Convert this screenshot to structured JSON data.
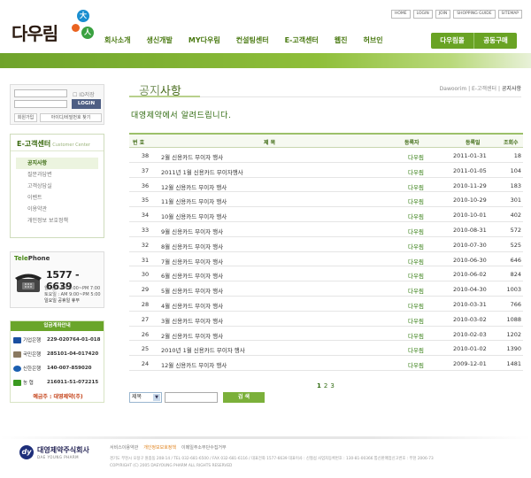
{
  "brand": {
    "tagline": "",
    "name": "다우림",
    "dot1": "大",
    "dot3": "人"
  },
  "util_links": [
    "HOME",
    "LOGIN",
    "JOIN",
    "SHOPPING GUIDE",
    "SITEMAP"
  ],
  "gnb": [
    "회사소개",
    "생신개발",
    "MY다우림",
    "컨설팅센터",
    "E-고객센터",
    "웹진",
    "허브인"
  ],
  "shop_buttons": [
    "다우림몰",
    "공동구매"
  ],
  "login": {
    "save_id": "ID저장",
    "login_button": "LOGIN",
    "join": "회원가입",
    "find": "아이디/비밀번호 찾기"
  },
  "side": {
    "title": "E-고객센터",
    "subtitle": "Customer Center",
    "items": [
      "공지사항",
      "질문과답변",
      "고객상담실",
      "이벤트",
      "이용약관",
      "개인정보 보호정책"
    ],
    "active_index": 0
  },
  "telephone": {
    "title_a": "Tele",
    "title_b": "Phone",
    "number": "1577 - 6639",
    "hours1": "월~금 : AM 9:00~PM 7:00",
    "hours2": "토요일 : AM 9:00~PM 5:00",
    "hours3": "일요일 공휴일 휴무"
  },
  "bank": {
    "title": "입금계좌안내",
    "accounts": [
      {
        "bank": "기업은행",
        "account": "229-020764-01-018",
        "color": "#1a4fa0",
        "icon": "ibk-bank-icon"
      },
      {
        "bank": "국민은행",
        "account": "285101-04-017420",
        "color": "#8a7a60",
        "icon": "kb-bank-icon"
      },
      {
        "bank": "신한은행",
        "account": "140-007-859020",
        "color": "#1b5fb0",
        "icon": "shinhan-bank-icon"
      },
      {
        "bank": "농 협",
        "account": "216011-51-072215",
        "color": "#3a9a20",
        "icon": "nh-bank-icon"
      }
    ],
    "holder": "예금주 : 대영제약(주)"
  },
  "page": {
    "title_a": "공지",
    "title_b": "사항",
    "breadcrumb": [
      "Dawoorim",
      "E-고객센터",
      "공지사항"
    ],
    "notice": "대영제약에서 알려드립니다."
  },
  "board": {
    "headers": [
      "번 호",
      "제 목",
      "등록자",
      "등록일",
      "조회수"
    ],
    "rows": [
      {
        "num": "38",
        "subject": "2월 신용카드 무이자 행사",
        "author": "다우림",
        "date": "2011-01-31",
        "hits": "18"
      },
      {
        "num": "37",
        "subject": "2011년 1월 신용카드 무이자행사",
        "author": "다우림",
        "date": "2011-01-05",
        "hits": "104"
      },
      {
        "num": "36",
        "subject": "12월 신용카드 무이자 행사",
        "author": "다우림",
        "date": "2010-11-29",
        "hits": "183"
      },
      {
        "num": "35",
        "subject": "11월 신용카드 무이자 행사",
        "author": "다우림",
        "date": "2010-10-29",
        "hits": "301"
      },
      {
        "num": "34",
        "subject": "10월 신용카드 무이자 행사",
        "author": "다우림",
        "date": "2010-10-01",
        "hits": "402"
      },
      {
        "num": "33",
        "subject": "9월 신용카드 무이자 행사",
        "author": "다우림",
        "date": "2010-08-31",
        "hits": "572"
      },
      {
        "num": "32",
        "subject": "8월 신용카드 무이자 행사",
        "author": "다우림",
        "date": "2010-07-30",
        "hits": "525"
      },
      {
        "num": "31",
        "subject": "7월 신용카드 무이자 행사",
        "author": "다우림",
        "date": "2010-06-30",
        "hits": "646"
      },
      {
        "num": "30",
        "subject": "6월 신용카드 무이자 행사",
        "author": "다우림",
        "date": "2010-06-02",
        "hits": "824"
      },
      {
        "num": "29",
        "subject": "5월 신용카드 무이자 행사",
        "author": "다우림",
        "date": "2010-04-30",
        "hits": "1003"
      },
      {
        "num": "28",
        "subject": "4월 신용카드 무이자 행사",
        "author": "다우림",
        "date": "2010-03-31",
        "hits": "766"
      },
      {
        "num": "27",
        "subject": "3월 신용카드 무이자 행사",
        "author": "다우림",
        "date": "2010-03-02",
        "hits": "1088"
      },
      {
        "num": "26",
        "subject": "2월 신용카드 무이자 행사",
        "author": "다우림",
        "date": "2010-02-03",
        "hits": "1202"
      },
      {
        "num": "25",
        "subject": "2010년 1월 신용카드 무이자 행사",
        "author": "다우림",
        "date": "2010-01-02",
        "hits": "1390"
      },
      {
        "num": "24",
        "subject": "12월 신용카드 무이자 행사",
        "author": "다우림",
        "date": "2009-12-01",
        "hits": "1481"
      }
    ]
  },
  "pager": [
    "1",
    "2",
    "3"
  ],
  "search": {
    "field": "제목",
    "button": "검 색"
  },
  "footer": {
    "company": "대영제약주식회사",
    "company_en": "DAE YOUNG PHARM",
    "links": [
      "서비스이용약관",
      "개인정보보호정책",
      "이메일주소무단수집거부"
    ],
    "info1": "경기도 부천시 오정구 원종동 208-14 / TEL 032-681-6500 / FAX 032-681-6116 / 대표전화 1577-6639 대표이사 : 신철섭 사업자등록번호 : 130-81-00366 통신판매업신고번호 : 부천 2006-73",
    "info2": "COPYRIGHT (C) 2005 DAEYOUNG PHARM ALL RIGHTS RESERVED"
  }
}
